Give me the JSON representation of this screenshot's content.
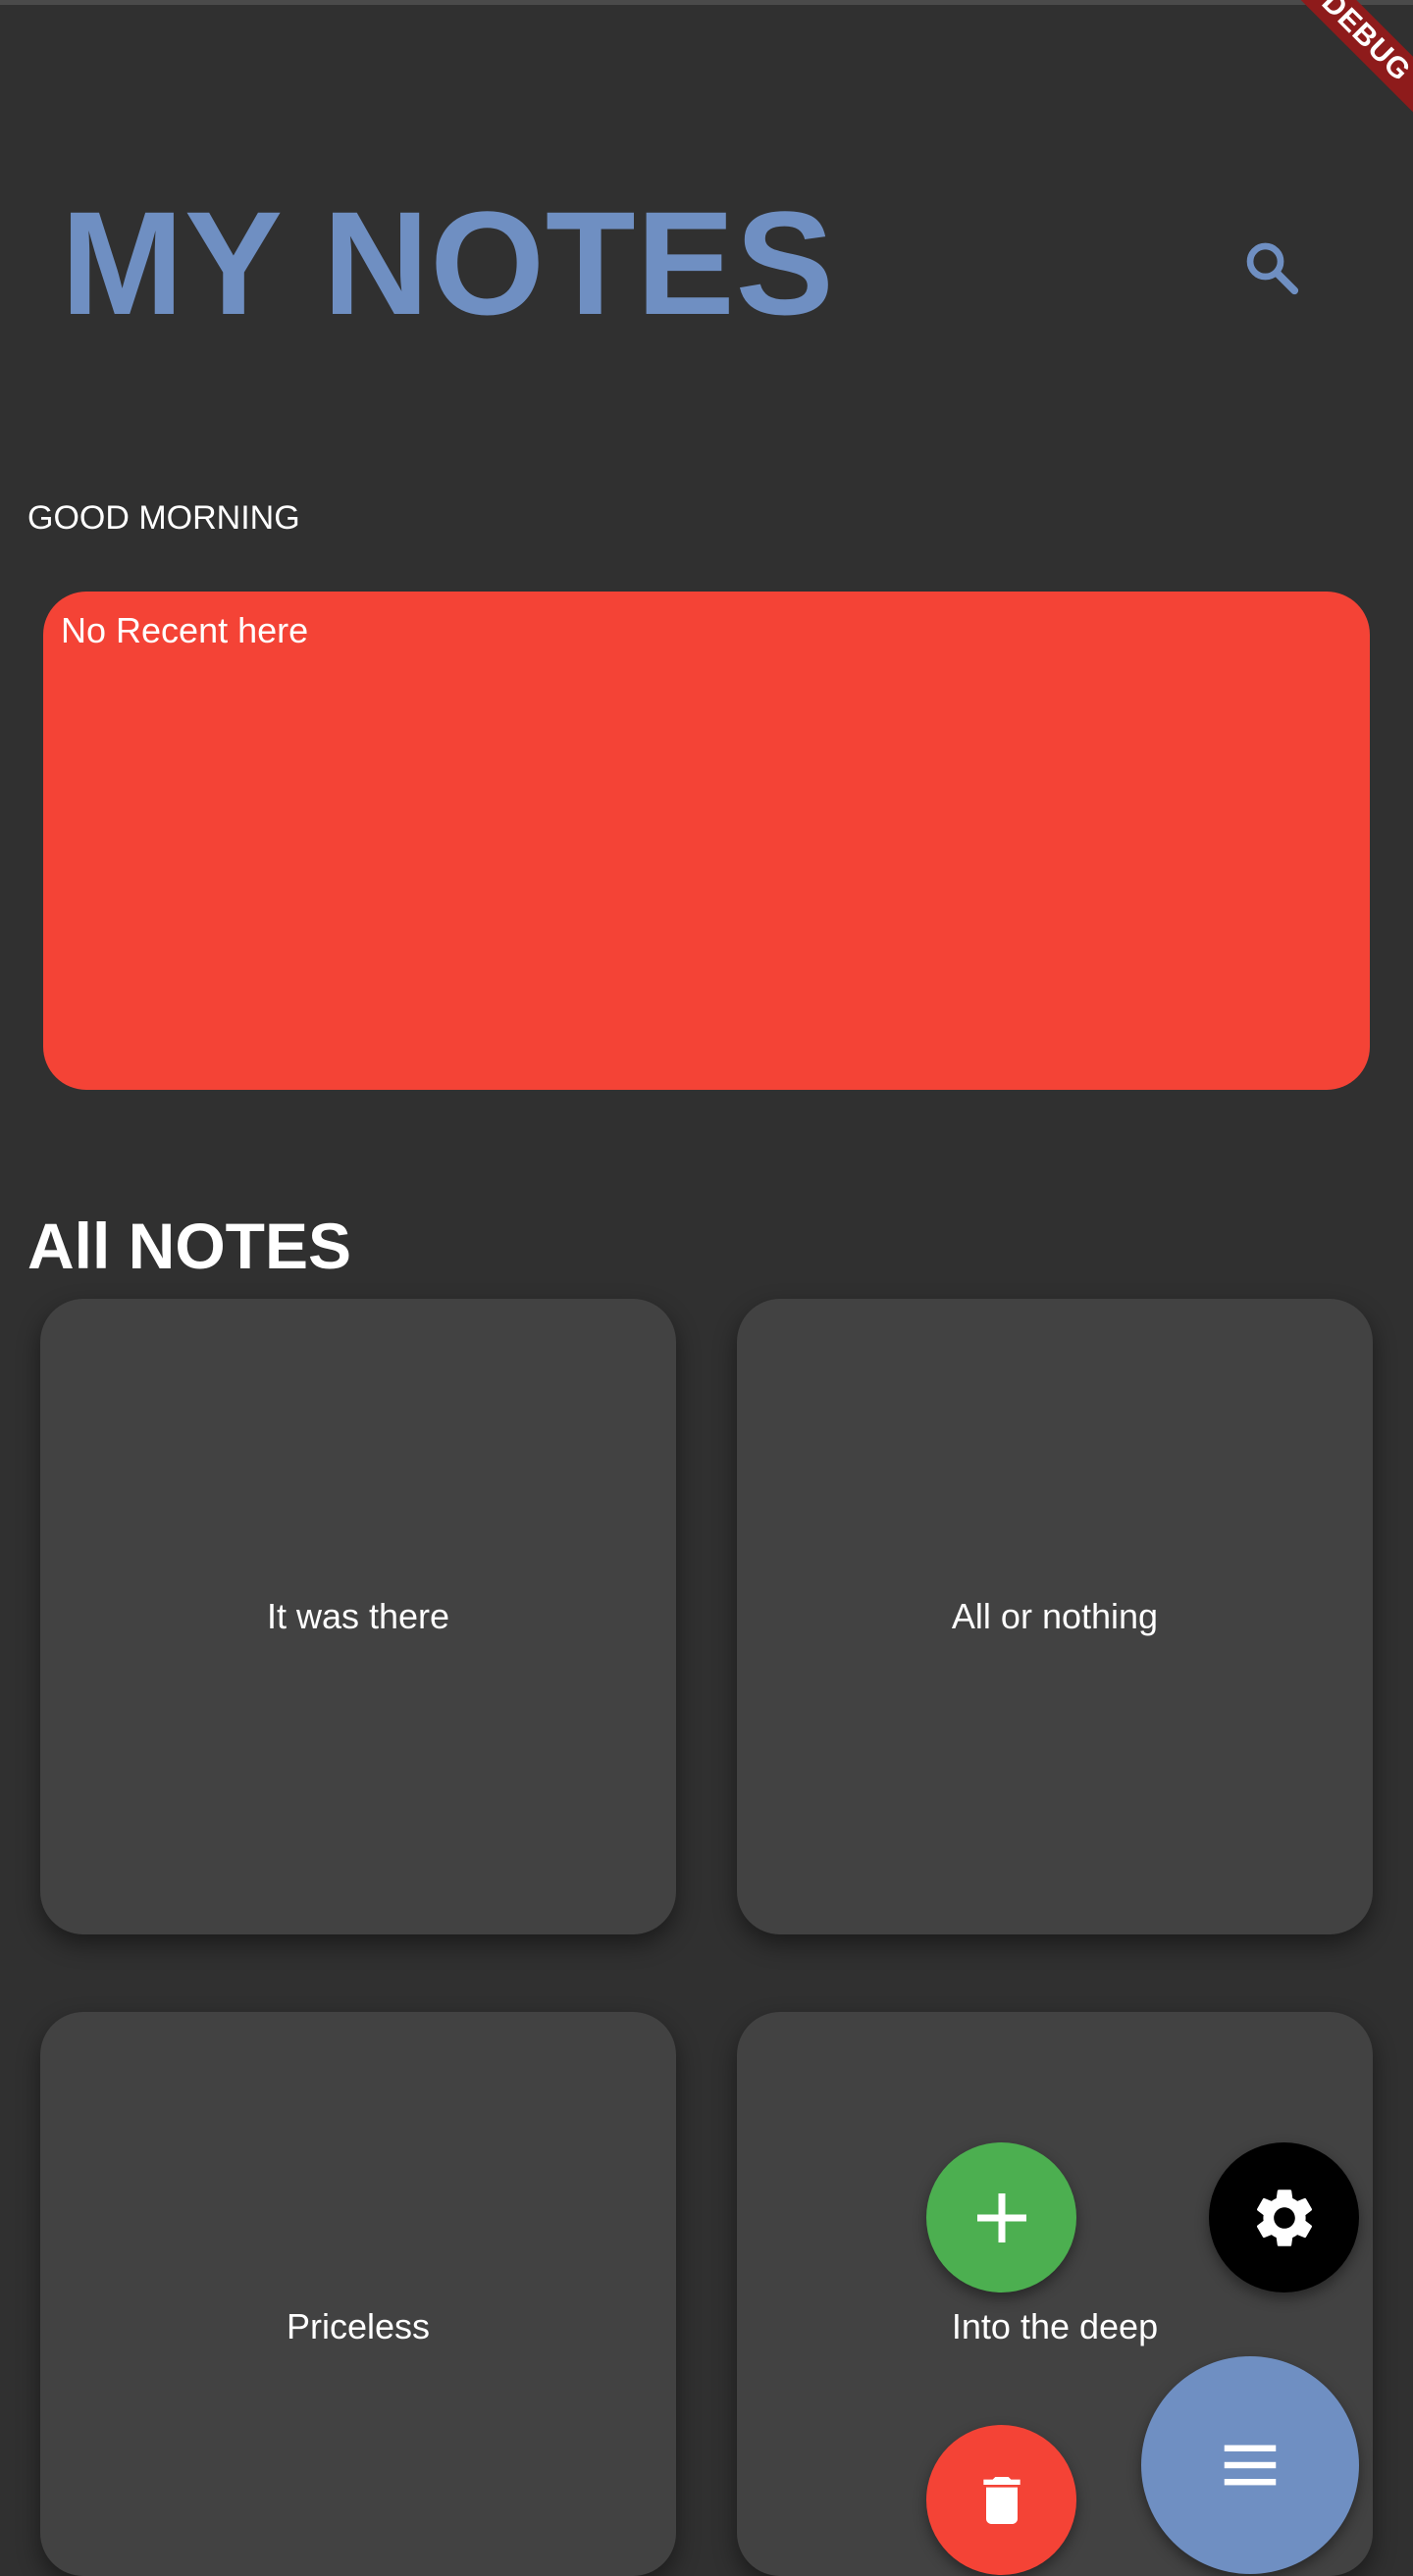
{
  "app": {
    "title": "MY NOTES",
    "debug_banner": "DEBUG"
  },
  "header": {
    "search_icon": "search-icon"
  },
  "greeting": "GOOD MORNING",
  "recent": {
    "empty_message": "No Recent here",
    "card_color": "#f44336"
  },
  "all_notes": {
    "section_title": "All NOTES",
    "notes": [
      {
        "title": "It was there"
      },
      {
        "title": "All or nothing"
      },
      {
        "title": "Priceless"
      },
      {
        "title": "Into the deep"
      }
    ]
  },
  "fab_menu": {
    "add_icon": "plus-icon",
    "settings_icon": "gear-icon",
    "delete_icon": "trash-icon",
    "menu_icon": "menu-icon",
    "colors": {
      "add": "#4caf50",
      "settings": "#000000",
      "delete": "#f44336",
      "menu": "#6f8fc2"
    }
  },
  "theme": {
    "background": "#303030",
    "card": "#424242",
    "accent": "#6f8fc2"
  }
}
